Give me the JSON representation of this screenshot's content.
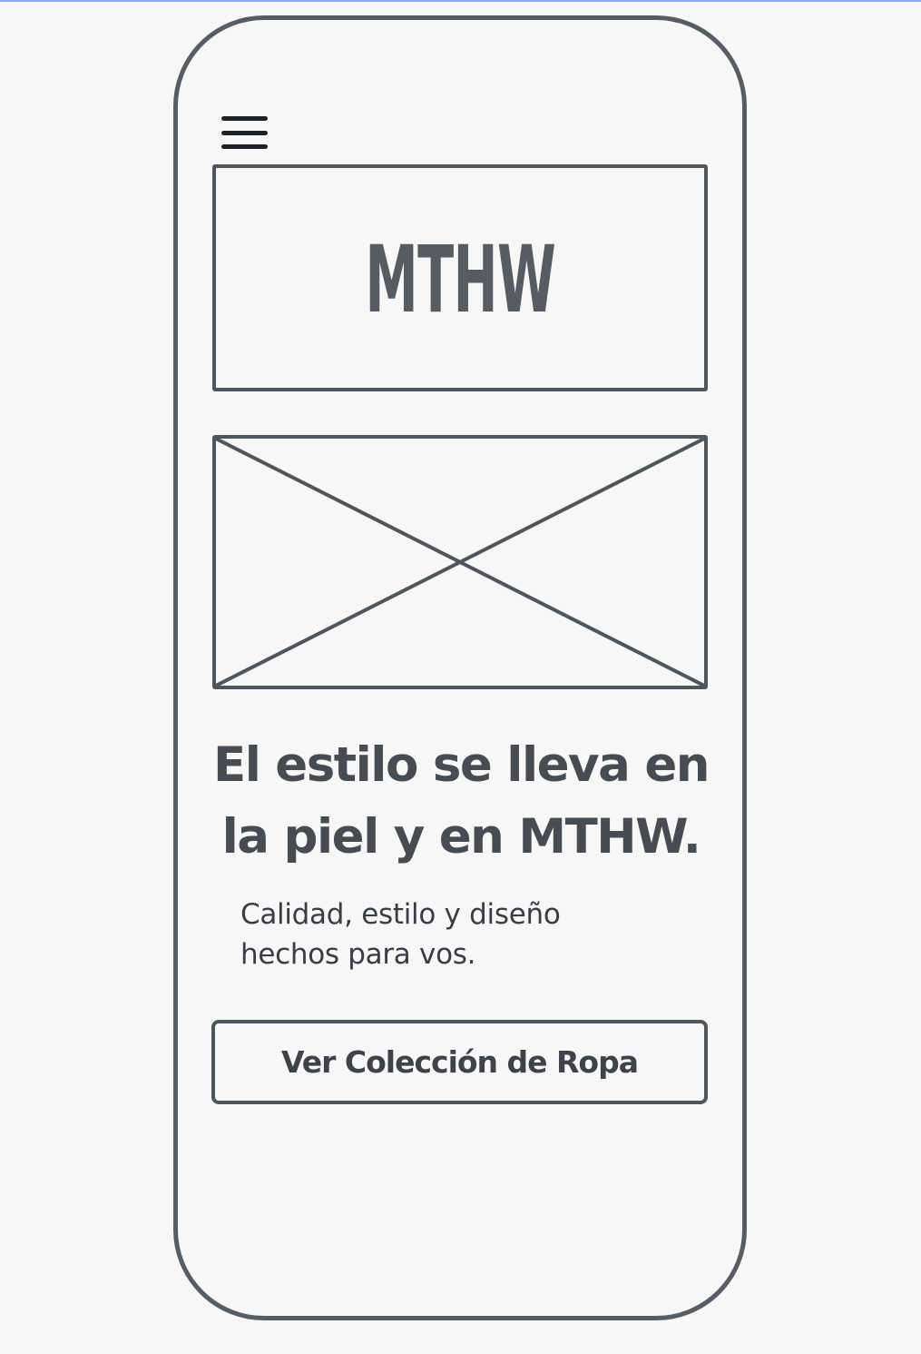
{
  "brand": {
    "logo_text": "MTHW"
  },
  "hero": {
    "headline_line1": "El estilo se lleva en",
    "headline_line2": "la piel y en MTHW.",
    "subtitle_line1": "Calidad, estilo y diseño",
    "subtitle_line2": "hechos para vos."
  },
  "cta": {
    "label": "Ver Colección de Ropa"
  },
  "icons": {
    "menu": "hamburger-menu-icon",
    "image": "image-placeholder-icon"
  },
  "colors": {
    "outline": "#575d64",
    "text": "#474c52",
    "background": "#f7f7f8",
    "top_rule": "#8ea9ee"
  }
}
